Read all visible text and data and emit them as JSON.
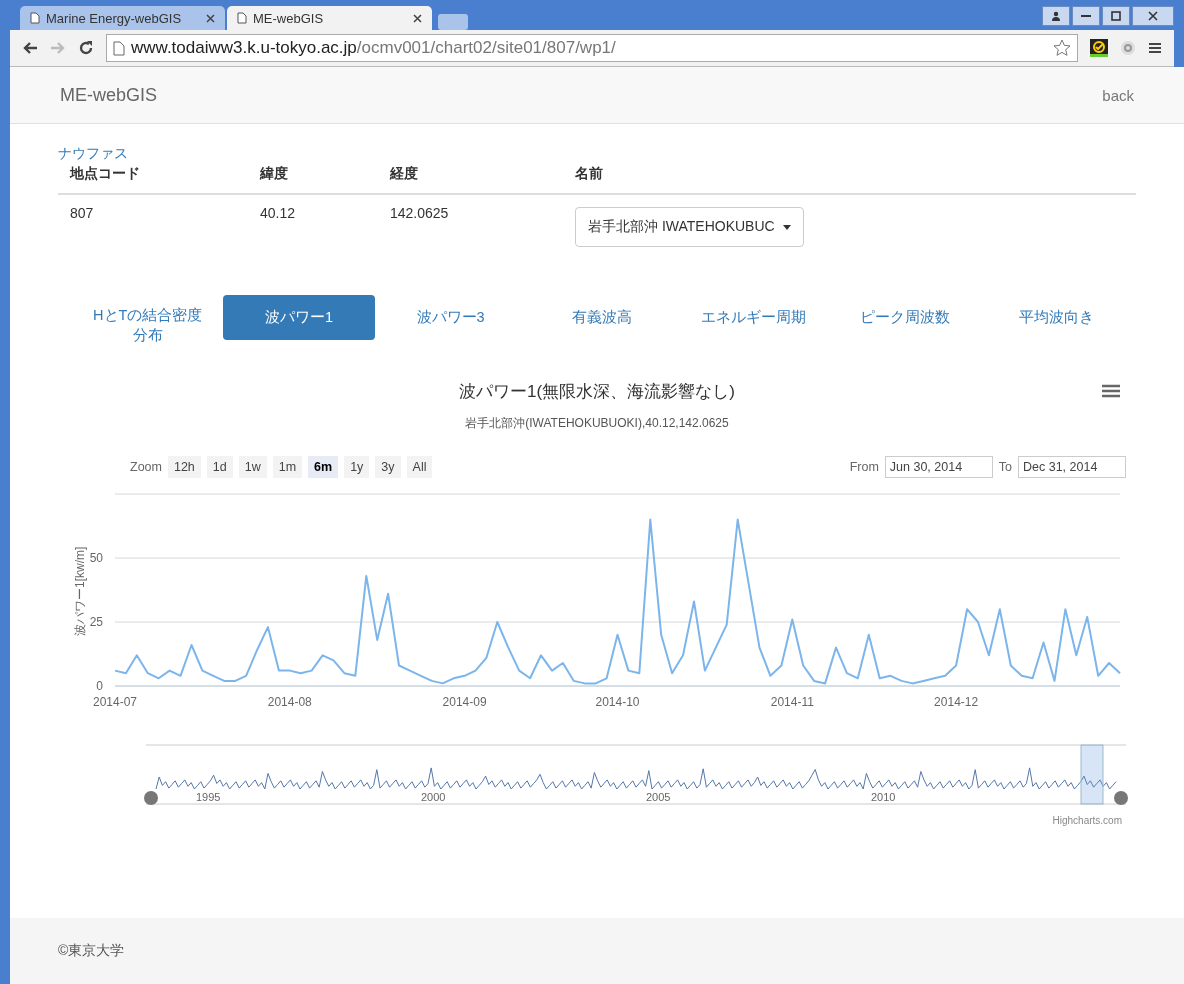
{
  "browser": {
    "tabs": [
      {
        "title": "Marine Energy-webGIS",
        "selected": false
      },
      {
        "title": "ME-webGIS",
        "selected": true
      }
    ],
    "url": {
      "host": "www.todaiww3.k.u-tokyo.ac.jp",
      "path": "/ocmv001/chart02/site01/807/wp1/"
    }
  },
  "header": {
    "brand": "ME-webGIS",
    "back": "back"
  },
  "source_link": "ナウファス",
  "site_table": {
    "columns": [
      "地点コード",
      "緯度",
      "経度",
      "名前"
    ],
    "row": {
      "code": "807",
      "lat": "40.12",
      "lon": "142.0625",
      "name": "岩手北部沖 IWATEHOKUBUC"
    }
  },
  "tabs": [
    {
      "label": "HとTの結合密度分布",
      "selected": false
    },
    {
      "label": "波パワー1",
      "selected": true
    },
    {
      "label": "波パワー3",
      "selected": false
    },
    {
      "label": "有義波高",
      "selected": false
    },
    {
      "label": "エネルギー周期",
      "selected": false
    },
    {
      "label": "ピーク周波数",
      "selected": false
    },
    {
      "label": "平均波向き",
      "selected": false
    }
  ],
  "chart": {
    "title": "波パワー1(無限水深、海流影響なし)",
    "subtitle": "岩手北部沖(IWATEHOKUBUOKI),40.12,142.0625",
    "zoom_label": "Zoom",
    "zoom_buttons": [
      {
        "label": "12h",
        "selected": false
      },
      {
        "label": "1d",
        "selected": false
      },
      {
        "label": "1w",
        "selected": false
      },
      {
        "label": "1m",
        "selected": false
      },
      {
        "label": "6m",
        "selected": true
      },
      {
        "label": "1y",
        "selected": false
      },
      {
        "label": "3y",
        "selected": false
      },
      {
        "label": "All",
        "selected": false
      }
    ],
    "from_label": "From",
    "from": "Jun 30, 2014",
    "to_label": "To",
    "to": "Dec 31, 2014",
    "chart_data": {
      "type": "line",
      "ylabel": "波パワー1[kw/m]",
      "ylim": [
        0,
        75
      ],
      "yticks": [
        0,
        25,
        50
      ],
      "categories": [
        "2014-07",
        null,
        null,
        null,
        null,
        null,
        null,
        null,
        null,
        null,
        null,
        null,
        null,
        null,
        null,
        null,
        "2014-08",
        null,
        null,
        null,
        null,
        null,
        null,
        null,
        null,
        null,
        null,
        null,
        null,
        null,
        null,
        null,
        "2014-09",
        null,
        null,
        null,
        null,
        null,
        null,
        null,
        null,
        null,
        null,
        null,
        null,
        null,
        "2014-10",
        null,
        null,
        null,
        null,
        null,
        null,
        null,
        null,
        null,
        null,
        null,
        null,
        null,
        null,
        null,
        "2014-11",
        null,
        null,
        null,
        null,
        null,
        null,
        null,
        null,
        null,
        null,
        null,
        null,
        null,
        null,
        "2014-12",
        null,
        null,
        null,
        null,
        null,
        null,
        null,
        null,
        null,
        null,
        null,
        null,
        null,
        null,
        null
      ],
      "series": [
        {
          "color": "#7cb5ec",
          "values": [
            6,
            5,
            12,
            5,
            3,
            6,
            4,
            16,
            6,
            4,
            2,
            2,
            4,
            14,
            23,
            6,
            6,
            5,
            6,
            12,
            10,
            5,
            4,
            43,
            18,
            36,
            8,
            6,
            4,
            2,
            1,
            3,
            4,
            6,
            11,
            25,
            15,
            6,
            3,
            12,
            6,
            9,
            2,
            1,
            1,
            3,
            20,
            6,
            5,
            65,
            20,
            5,
            12,
            33,
            6,
            15,
            24,
            65,
            40,
            15,
            4,
            8,
            26,
            8,
            2,
            1,
            15,
            5,
            3,
            20,
            3,
            4,
            2,
            1,
            2,
            3,
            4,
            8,
            30,
            25,
            12,
            30,
            8,
            4,
            3,
            17,
            2,
            30,
            12,
            27,
            4,
            9,
            5
          ]
        }
      ]
    },
    "navigator_labels": [
      "1995",
      "2000",
      "2005",
      "2010"
    ],
    "credit": "Highcharts.com"
  },
  "footer": "©東京大学"
}
